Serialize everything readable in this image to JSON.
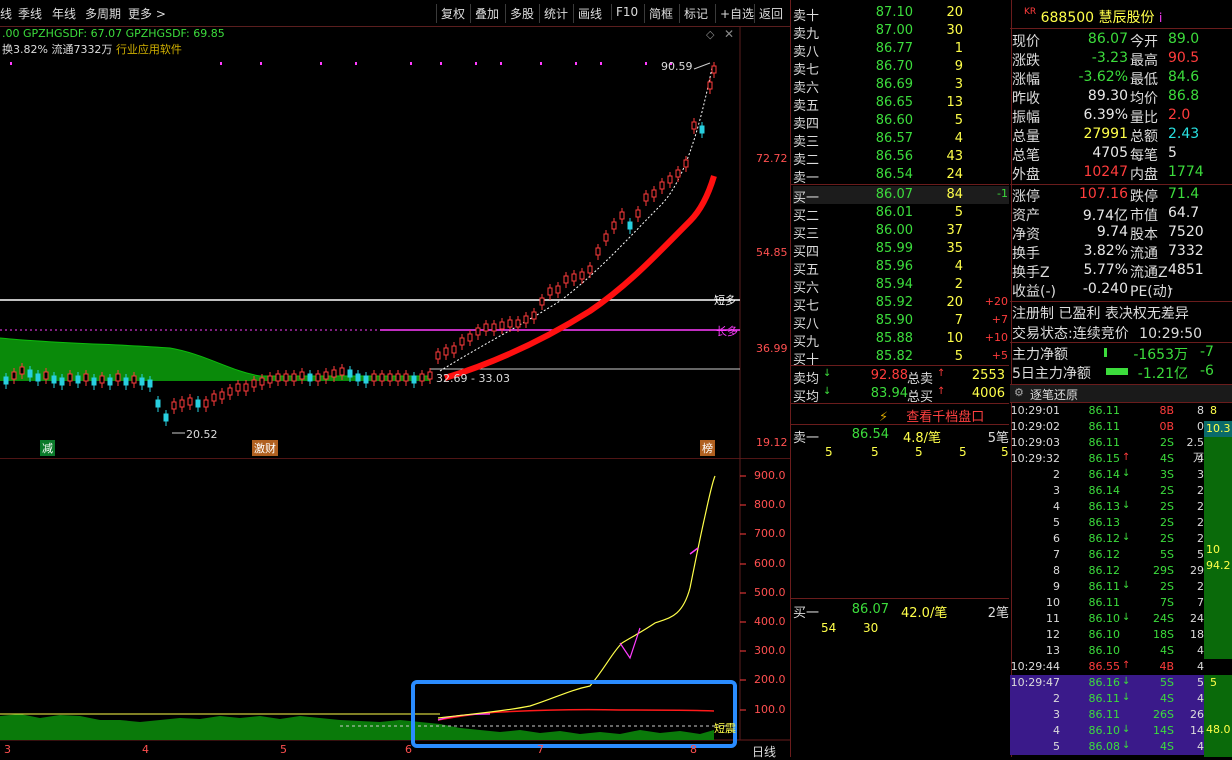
{
  "toolbar": {
    "left": [
      "线",
      "季线",
      "年线",
      "多周期",
      "更多 >"
    ],
    "right": [
      "复权",
      "叠加",
      "多股",
      "统计",
      "画线",
      "F10",
      "简框",
      "标记",
      "+自选",
      "返回"
    ]
  },
  "chart": {
    "info1": ".00  GPZHGSDF: 67.07  GPZHGSDF: 69.85",
    "info2_prefix": "换3.82% 流通7332万",
    "info2_industry": "行业应用软件",
    "y_labels": [
      "72.72",
      "54.85",
      "36.99",
      "19.12"
    ],
    "high_label": "90.59",
    "low_label": "20.52",
    "range_label": "32.69 - 33.03",
    "short_label": "短多",
    "long_label": "长多",
    "badge1": "减",
    "badge2": "激财",
    "badge3": "榜",
    "sub_y_labels": [
      "900.0",
      "800.0",
      "700.0",
      "600.0",
      "500.0",
      "400.0",
      "300.0",
      "200.0",
      "100.0"
    ],
    "sub_label": "短震",
    "x_labels": [
      "3",
      "4",
      "5",
      "6",
      "7",
      "8"
    ],
    "period": "日线"
  },
  "orderbook": {
    "asks": [
      {
        "label": "卖十",
        "price": "87.10",
        "vol": "20"
      },
      {
        "label": "卖九",
        "price": "87.00",
        "vol": "30"
      },
      {
        "label": "卖八",
        "price": "86.77",
        "vol": "1"
      },
      {
        "label": "卖七",
        "price": "86.70",
        "vol": "9"
      },
      {
        "label": "卖六",
        "price": "86.69",
        "vol": "3"
      },
      {
        "label": "卖五",
        "price": "86.65",
        "vol": "13"
      },
      {
        "label": "卖四",
        "price": "86.60",
        "vol": "5"
      },
      {
        "label": "卖三",
        "price": "86.57",
        "vol": "4"
      },
      {
        "label": "卖二",
        "price": "86.56",
        "vol": "43"
      },
      {
        "label": "卖一",
        "price": "86.54",
        "vol": "24"
      }
    ],
    "bids": [
      {
        "label": "买一",
        "price": "86.07",
        "vol": "84",
        "chg": "-1"
      },
      {
        "label": "买二",
        "price": "86.01",
        "vol": "5",
        "chg": ""
      },
      {
        "label": "买三",
        "price": "86.00",
        "vol": "37",
        "chg": ""
      },
      {
        "label": "买四",
        "price": "85.99",
        "vol": "35",
        "chg": ""
      },
      {
        "label": "买五",
        "price": "85.96",
        "vol": "4",
        "chg": ""
      },
      {
        "label": "买六",
        "price": "85.94",
        "vol": "2",
        "chg": ""
      },
      {
        "label": "买七",
        "price": "85.92",
        "vol": "20",
        "chg": "+20"
      },
      {
        "label": "买八",
        "price": "85.90",
        "vol": "7",
        "chg": "+7"
      },
      {
        "label": "买九",
        "price": "85.88",
        "vol": "10",
        "chg": "+10"
      },
      {
        "label": "买十",
        "price": "85.82",
        "vol": "5",
        "chg": "+5"
      }
    ],
    "avg_sell_label": "卖均",
    "avg_sell": "92.88",
    "total_sell_label": "总卖",
    "total_sell": "2553",
    "avg_buy_label": "买均",
    "avg_buy": "83.94",
    "total_buy_label": "总买",
    "total_buy": "4006",
    "view_depth": "查看千档盘口",
    "sell1_label": "卖一",
    "sell1_price": "86.54",
    "sell1_avg": "4.8/笔",
    "sell1_count": "5笔",
    "sell1_queue": [
      "5",
      "5",
      "5",
      "5",
      "5"
    ],
    "buy1_label": "买一",
    "buy1_price": "86.07",
    "buy1_avg": "42.0/笔",
    "buy1_count": "2笔",
    "buy1_queue": [
      "54",
      "30"
    ]
  },
  "info": {
    "market_tag": "KR",
    "code": "688500",
    "name": "慧辰股份",
    "suffix": "i",
    "quotes": [
      {
        "k1": "现价",
        "v1": "86.07",
        "c1": "grn",
        "k2": "今开",
        "v2": "89.0",
        "c2": "grn"
      },
      {
        "k1": "涨跌",
        "v1": "-3.23",
        "c1": "grn",
        "k2": "最高",
        "v2": "90.5",
        "c2": "red"
      },
      {
        "k1": "涨幅",
        "v1": "-3.62%",
        "c1": "grn",
        "k2": "最低",
        "v2": "84.6",
        "c2": "grn"
      },
      {
        "k1": "昨收",
        "v1": "89.30",
        "c1": "wht",
        "k2": "均价",
        "v2": "86.8",
        "c2": "grn"
      },
      {
        "k1": "振幅",
        "v1": "6.39%",
        "c1": "wht",
        "k2": "量比",
        "v2": "2.0",
        "c2": "red"
      },
      {
        "k1": "总量",
        "v1": "27991",
        "c1": "yel",
        "k2": "总额",
        "v2": "2.43",
        "c2": "cyn"
      },
      {
        "k1": "总笔",
        "v1": "4705",
        "c1": "wht",
        "k2": "每笔",
        "v2": "5",
        "c2": "wht"
      },
      {
        "k1": "外盘",
        "v1": "10247",
        "c1": "red",
        "k2": "内盘",
        "v2": "1774",
        "c2": "grn"
      }
    ],
    "stats": [
      {
        "k1": "涨停",
        "v1": "107.16",
        "c1": "red",
        "k2": "跌停",
        "v2": "71.4",
        "c2": "grn"
      },
      {
        "k1": "资产",
        "v1": "9.74亿",
        "c1": "wht",
        "k2": "市值",
        "v2": "64.7",
        "c2": "wht"
      },
      {
        "k1": "净资",
        "v1": "9.74",
        "c1": "wht",
        "k2": "股本",
        "v2": "7520",
        "c2": "wht"
      },
      {
        "k1": "换手",
        "v1": "3.82%",
        "c1": "wht",
        "k2": "流通",
        "v2": "7332",
        "c2": "wht"
      },
      {
        "k1": "换手Z",
        "v1": "5.77%",
        "c1": "wht",
        "k2": "流通Z",
        "v2": "4851",
        "c2": "wht"
      },
      {
        "k1": "收益(-)",
        "v1": "-0.240",
        "c1": "wht",
        "k2": "PE(动)",
        "v2": "-",
        "c2": "wht"
      }
    ],
    "reg_line": "注册制 已盈利 表决权无差异",
    "trade_status_label": "交易状态:",
    "trade_status": "连续竞价",
    "trade_time": "10:29:50",
    "main_flow_label": "主力净额",
    "main_flow": "-1653万",
    "main_flow2": "-7",
    "main5_label": "5日主力净额",
    "main5": "-1.21亿",
    "main5_2": "-6",
    "tick_title": "逐笔还原",
    "ticks": [
      {
        "t": "10:29:01",
        "p": "86.11",
        "pc": "grn",
        "a": "",
        "v": "8B",
        "vc": "red",
        "n": "8"
      },
      {
        "t": "10:29:02",
        "p": "86.11",
        "pc": "grn",
        "a": "",
        "v": "0B",
        "vc": "red",
        "n": "0"
      },
      {
        "t": "10:29:03",
        "p": "86.11",
        "pc": "grn",
        "a": "",
        "v": "2S",
        "vc": "grn",
        "n": "2.5万"
      },
      {
        "t": "10:29:32",
        "p": "86.15",
        "pc": "grn",
        "a": "up",
        "v": "4S",
        "vc": "grn",
        "n": "4"
      },
      {
        "t": "2",
        "p": "86.14",
        "pc": "grn",
        "a": "dn",
        "v": "3S",
        "vc": "grn",
        "n": "3"
      },
      {
        "t": "3",
        "p": "86.14",
        "pc": "grn",
        "a": "",
        "v": "2S",
        "vc": "grn",
        "n": "2"
      },
      {
        "t": "4",
        "p": "86.13",
        "pc": "grn",
        "a": "dn",
        "v": "2S",
        "vc": "grn",
        "n": "2"
      },
      {
        "t": "5",
        "p": "86.13",
        "pc": "grn",
        "a": "",
        "v": "2S",
        "vc": "grn",
        "n": "2"
      },
      {
        "t": "6",
        "p": "86.12",
        "pc": "grn",
        "a": "dn",
        "v": "2S",
        "vc": "grn",
        "n": "2"
      },
      {
        "t": "7",
        "p": "86.12",
        "pc": "grn",
        "a": "",
        "v": "5S",
        "vc": "grn",
        "n": "5"
      },
      {
        "t": "8",
        "p": "86.12",
        "pc": "grn",
        "a": "",
        "v": "29S",
        "vc": "grn",
        "n": "29"
      },
      {
        "t": "9",
        "p": "86.11",
        "pc": "grn",
        "a": "dn",
        "v": "2S",
        "vc": "grn",
        "n": "2"
      },
      {
        "t": "10",
        "p": "86.11",
        "pc": "grn",
        "a": "",
        "v": "7S",
        "vc": "grn",
        "n": "7"
      },
      {
        "t": "11",
        "p": "86.10",
        "pc": "grn",
        "a": "dn",
        "v": "24S",
        "vc": "grn",
        "n": "24"
      },
      {
        "t": "12",
        "p": "86.10",
        "pc": "grn",
        "a": "",
        "v": "18S",
        "vc": "grn",
        "n": "18"
      },
      {
        "t": "13",
        "p": "86.10",
        "pc": "grn",
        "a": "",
        "v": "4S",
        "vc": "grn",
        "n": "4"
      },
      {
        "t": "10:29:44",
        "p": "86.55",
        "pc": "red",
        "a": "up",
        "v": "4B",
        "vc": "red",
        "n": "4"
      },
      {
        "t": "10:29:47",
        "p": "86.16",
        "pc": "grn",
        "a": "dn",
        "v": "5S",
        "vc": "grn",
        "n": "5"
      },
      {
        "t": "2",
        "p": "86.11",
        "pc": "grn",
        "a": "dn",
        "v": "4S",
        "vc": "grn",
        "n": "4"
      },
      {
        "t": "3",
        "p": "86.11",
        "pc": "grn",
        "a": "",
        "v": "26S",
        "vc": "grn",
        "n": "26"
      },
      {
        "t": "4",
        "p": "86.10",
        "pc": "grn",
        "a": "dn",
        "v": "14S",
        "vc": "grn",
        "n": "14"
      },
      {
        "t": "5",
        "p": "86.08",
        "pc": "grn",
        "a": "dn",
        "v": "4S",
        "vc": "grn",
        "n": "4"
      }
    ],
    "side_labels": [
      "8",
      "10.3",
      "10",
      "94.2",
      "5",
      "48.0"
    ]
  }
}
